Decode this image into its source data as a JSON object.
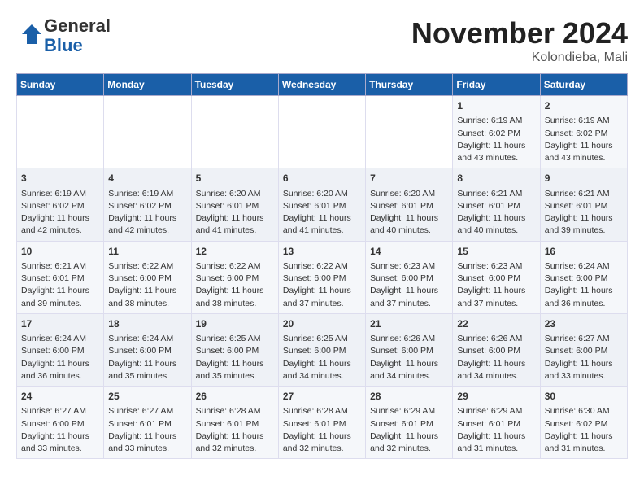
{
  "header": {
    "logo_general": "General",
    "logo_blue": "Blue",
    "month_title": "November 2024",
    "location": "Kolondieba, Mali"
  },
  "days_of_week": [
    "Sunday",
    "Monday",
    "Tuesday",
    "Wednesday",
    "Thursday",
    "Friday",
    "Saturday"
  ],
  "weeks": [
    [
      {
        "day": "",
        "info": ""
      },
      {
        "day": "",
        "info": ""
      },
      {
        "day": "",
        "info": ""
      },
      {
        "day": "",
        "info": ""
      },
      {
        "day": "",
        "info": ""
      },
      {
        "day": "1",
        "info": "Sunrise: 6:19 AM\nSunset: 6:02 PM\nDaylight: 11 hours and 43 minutes."
      },
      {
        "day": "2",
        "info": "Sunrise: 6:19 AM\nSunset: 6:02 PM\nDaylight: 11 hours and 43 minutes."
      }
    ],
    [
      {
        "day": "3",
        "info": "Sunrise: 6:19 AM\nSunset: 6:02 PM\nDaylight: 11 hours and 42 minutes."
      },
      {
        "day": "4",
        "info": "Sunrise: 6:19 AM\nSunset: 6:02 PM\nDaylight: 11 hours and 42 minutes."
      },
      {
        "day": "5",
        "info": "Sunrise: 6:20 AM\nSunset: 6:01 PM\nDaylight: 11 hours and 41 minutes."
      },
      {
        "day": "6",
        "info": "Sunrise: 6:20 AM\nSunset: 6:01 PM\nDaylight: 11 hours and 41 minutes."
      },
      {
        "day": "7",
        "info": "Sunrise: 6:20 AM\nSunset: 6:01 PM\nDaylight: 11 hours and 40 minutes."
      },
      {
        "day": "8",
        "info": "Sunrise: 6:21 AM\nSunset: 6:01 PM\nDaylight: 11 hours and 40 minutes."
      },
      {
        "day": "9",
        "info": "Sunrise: 6:21 AM\nSunset: 6:01 PM\nDaylight: 11 hours and 39 minutes."
      }
    ],
    [
      {
        "day": "10",
        "info": "Sunrise: 6:21 AM\nSunset: 6:01 PM\nDaylight: 11 hours and 39 minutes."
      },
      {
        "day": "11",
        "info": "Sunrise: 6:22 AM\nSunset: 6:00 PM\nDaylight: 11 hours and 38 minutes."
      },
      {
        "day": "12",
        "info": "Sunrise: 6:22 AM\nSunset: 6:00 PM\nDaylight: 11 hours and 38 minutes."
      },
      {
        "day": "13",
        "info": "Sunrise: 6:22 AM\nSunset: 6:00 PM\nDaylight: 11 hours and 37 minutes."
      },
      {
        "day": "14",
        "info": "Sunrise: 6:23 AM\nSunset: 6:00 PM\nDaylight: 11 hours and 37 minutes."
      },
      {
        "day": "15",
        "info": "Sunrise: 6:23 AM\nSunset: 6:00 PM\nDaylight: 11 hours and 37 minutes."
      },
      {
        "day": "16",
        "info": "Sunrise: 6:24 AM\nSunset: 6:00 PM\nDaylight: 11 hours and 36 minutes."
      }
    ],
    [
      {
        "day": "17",
        "info": "Sunrise: 6:24 AM\nSunset: 6:00 PM\nDaylight: 11 hours and 36 minutes."
      },
      {
        "day": "18",
        "info": "Sunrise: 6:24 AM\nSunset: 6:00 PM\nDaylight: 11 hours and 35 minutes."
      },
      {
        "day": "19",
        "info": "Sunrise: 6:25 AM\nSunset: 6:00 PM\nDaylight: 11 hours and 35 minutes."
      },
      {
        "day": "20",
        "info": "Sunrise: 6:25 AM\nSunset: 6:00 PM\nDaylight: 11 hours and 34 minutes."
      },
      {
        "day": "21",
        "info": "Sunrise: 6:26 AM\nSunset: 6:00 PM\nDaylight: 11 hours and 34 minutes."
      },
      {
        "day": "22",
        "info": "Sunrise: 6:26 AM\nSunset: 6:00 PM\nDaylight: 11 hours and 34 minutes."
      },
      {
        "day": "23",
        "info": "Sunrise: 6:27 AM\nSunset: 6:00 PM\nDaylight: 11 hours and 33 minutes."
      }
    ],
    [
      {
        "day": "24",
        "info": "Sunrise: 6:27 AM\nSunset: 6:00 PM\nDaylight: 11 hours and 33 minutes."
      },
      {
        "day": "25",
        "info": "Sunrise: 6:27 AM\nSunset: 6:01 PM\nDaylight: 11 hours and 33 minutes."
      },
      {
        "day": "26",
        "info": "Sunrise: 6:28 AM\nSunset: 6:01 PM\nDaylight: 11 hours and 32 minutes."
      },
      {
        "day": "27",
        "info": "Sunrise: 6:28 AM\nSunset: 6:01 PM\nDaylight: 11 hours and 32 minutes."
      },
      {
        "day": "28",
        "info": "Sunrise: 6:29 AM\nSunset: 6:01 PM\nDaylight: 11 hours and 32 minutes."
      },
      {
        "day": "29",
        "info": "Sunrise: 6:29 AM\nSunset: 6:01 PM\nDaylight: 11 hours and 31 minutes."
      },
      {
        "day": "30",
        "info": "Sunrise: 6:30 AM\nSunset: 6:02 PM\nDaylight: 11 hours and 31 minutes."
      }
    ]
  ]
}
